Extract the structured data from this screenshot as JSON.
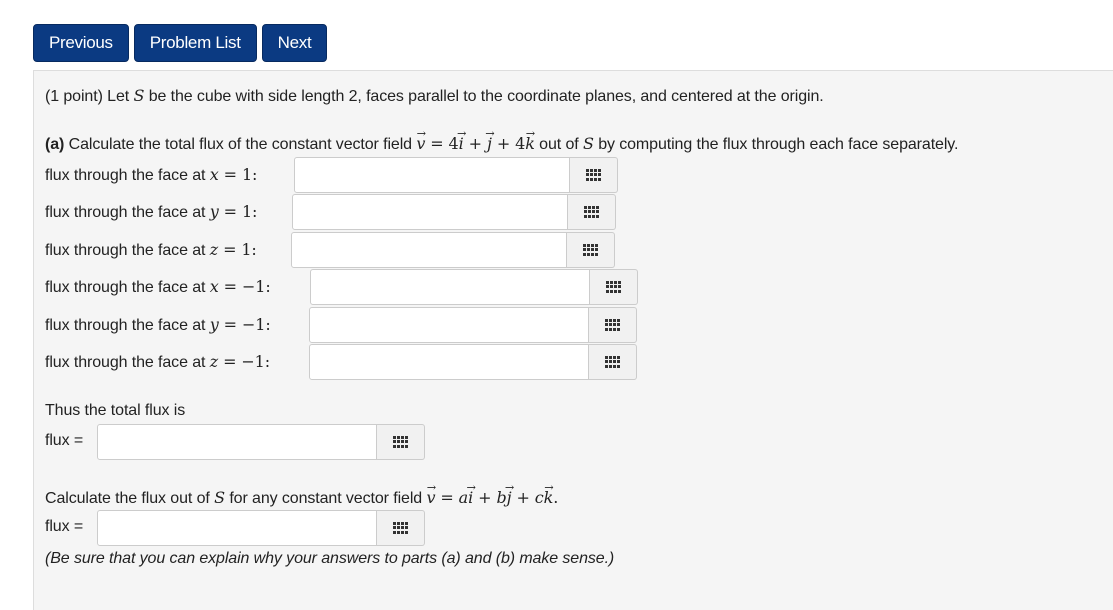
{
  "nav": {
    "previous": "Previous",
    "problem_list": "Problem List",
    "next": "Next"
  },
  "problem": {
    "intro_points": "(1 point) Let",
    "intro_S": "S",
    "intro_rest": "be the cube with side length 2, faces parallel to the coordinate planes, and centered at the origin.",
    "part_a_label": "(a)",
    "part_a_text": "Calculate the total flux of the constant vector field",
    "part_a_field": {
      "v": "v",
      "eq": " = 4",
      "i": "i",
      "plus1": " + ",
      "j": "j",
      "plus2": " + 4",
      "k": "k"
    },
    "part_a_tail_pre": "out of",
    "part_a_tail_S": "S",
    "part_a_tail_post": "by computing the flux through each face separately.",
    "faces": [
      {
        "label": "flux through the face at",
        "var": "x",
        "val": " = 1:",
        "value": ""
      },
      {
        "label": "flux through the face at",
        "var": "y",
        "val": " = 1:",
        "value": ""
      },
      {
        "label": "flux through the face at",
        "var": "z",
        "val": " = 1:",
        "value": ""
      },
      {
        "label": "flux through the face at",
        "var": "x",
        "val": " = −1:",
        "value": ""
      },
      {
        "label": "flux through the face at",
        "var": "y",
        "val": " = −1:",
        "value": ""
      },
      {
        "label": "flux through the face at",
        "var": "z",
        "val": " = −1:",
        "value": ""
      }
    ],
    "thus_text": "Thus the total flux is",
    "flux_label": "flux =",
    "flux_value": "",
    "part_b_text": "Calculate the flux out of",
    "part_b_S": "S",
    "part_b_mid": "for any constant vector field",
    "part_b_field": {
      "v": "v",
      "eq": " = ",
      "a": "a",
      "i": "i",
      "plus1": " + ",
      "b": "b",
      "j": "j",
      "plus2": " + ",
      "c": "c",
      "k": "k",
      "dot": "."
    },
    "flux_label_b": "flux =",
    "flux_value_b": "",
    "note": "(Be sure that you can explain why your answers to parts (a) and (b) make sense.)"
  },
  "icons": {
    "palette": "grid-icon"
  },
  "colors": {
    "nav_button": "#0b3a82",
    "panel": "#f5f5f5"
  }
}
